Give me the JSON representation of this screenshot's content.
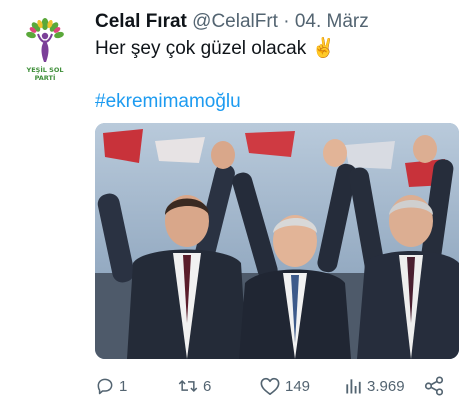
{
  "author": {
    "name": "Celal Fırat",
    "handle": "@CelalFrt",
    "separator": "·",
    "date": "04. März",
    "avatar_text_line1": "YEŞİL SOL",
    "avatar_text_line2": "PARTİ",
    "avatar_icon": "yesil-sol-parti-logo"
  },
  "tweet": {
    "text": "Her şey çok güzel olacak ✌️",
    "hashtag": "#ekremimamoğlu",
    "media_icon": "photo-three-men-raising-joined-hands"
  },
  "actions": {
    "reply_count": "1",
    "retweet_count": "6",
    "like_count": "149",
    "view_count": "3.969"
  },
  "colors": {
    "text": "#0f1419",
    "secondary": "#536471",
    "link": "#1d9bf0",
    "party_green": "#3f8f3a",
    "party_purple": "#7b3f98"
  }
}
